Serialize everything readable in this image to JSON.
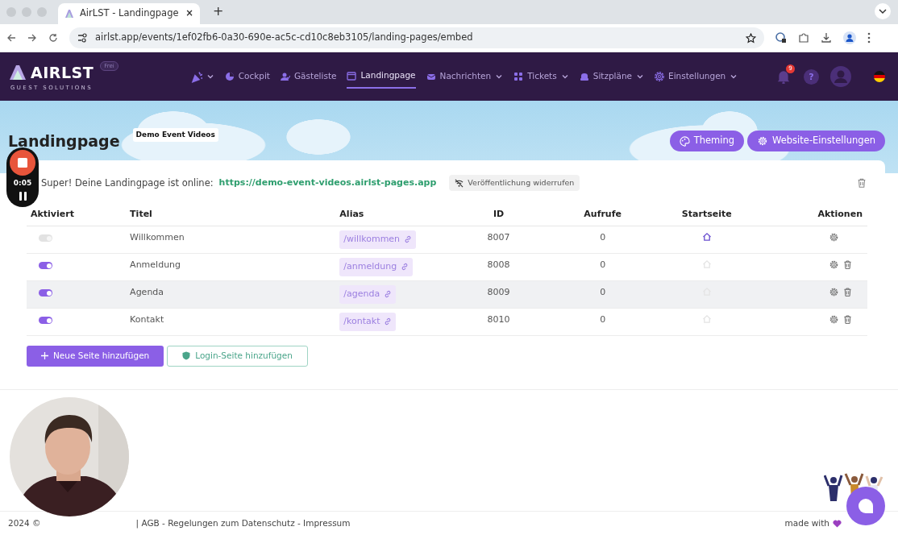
{
  "browser": {
    "tab_title": "AirLST - Landingpage",
    "tab_close": "×",
    "new_tab": "+",
    "url": "airlst.app/events/1ef02fb6-0a30-690e-ac5c-cd10c8eb3105/landing-pages/embed"
  },
  "app_nav": {
    "logo": "AIRLST",
    "logo_subtitle": "GUEST SOLUTIONS",
    "plan_badge": "Frei",
    "items": [
      {
        "kind": "party",
        "dropdown": true,
        "selected": false
      },
      {
        "kind": "cockpit",
        "label": "Cockpit",
        "dropdown": false,
        "selected": false
      },
      {
        "kind": "guests",
        "label": "Gästeliste",
        "dropdown": false,
        "selected": false
      },
      {
        "kind": "page",
        "label": "Landingpage",
        "dropdown": false,
        "selected": true
      },
      {
        "kind": "messages",
        "label": "Nachrichten",
        "dropdown": true,
        "selected": false
      },
      {
        "kind": "tickets",
        "label": "Tickets",
        "dropdown": true,
        "selected": false
      },
      {
        "kind": "seats",
        "label": "Sitzpläne",
        "dropdown": true,
        "selected": false
      },
      {
        "kind": "settings",
        "label": "Einstellungen",
        "dropdown": true,
        "selected": false
      }
    ],
    "notification_count": "9",
    "help": "?"
  },
  "page": {
    "title": "Landingpage",
    "event_badge": "Demo Event Videos",
    "buttons": [
      {
        "kind": "palette",
        "label": "Theming"
      },
      {
        "kind": "gear",
        "label": "Website-Einstellungen"
      }
    ]
  },
  "status": {
    "message": "Super! Deine Landingpage ist online:",
    "url": "https://demo-event-videos.airlst-pages.app",
    "unpublish": "Veröffentlichung widerrufen"
  },
  "table": {
    "columns": [
      "Aktiviert",
      "Titel",
      "Alias",
      "ID",
      "Aufrufe",
      "Startseite",
      "Aktionen"
    ],
    "rows": [
      {
        "active": true,
        "disabled": true,
        "title": "Willkommen",
        "alias": "/willkommen",
        "id": "8007",
        "views": "0",
        "start_page": true,
        "deletable": false,
        "hovered": false
      },
      {
        "active": true,
        "disabled": false,
        "title": "Anmeldung",
        "alias": "/anmeldung",
        "id": "8008",
        "views": "0",
        "start_page": false,
        "deletable": true,
        "hovered": false
      },
      {
        "active": true,
        "disabled": false,
        "title": "Agenda",
        "alias": "/agenda",
        "id": "8009",
        "views": "0",
        "start_page": false,
        "deletable": true,
        "hovered": true
      },
      {
        "active": true,
        "disabled": false,
        "title": "Kontakt",
        "alias": "/kontakt",
        "id": "8010",
        "views": "0",
        "start_page": false,
        "deletable": true,
        "hovered": false
      }
    ]
  },
  "actions": [
    {
      "kind": "primary",
      "label": "Neue Seite hinzufügen"
    },
    {
      "kind": "outline",
      "label": "Login-Seite hinzufügen"
    }
  ],
  "recorder": {
    "time": "0:05"
  },
  "footer": {
    "copyright": "2024 ©",
    "links": "| AGB - Regelungen zum Datenschutz - Impressum",
    "made_with": "made with"
  }
}
